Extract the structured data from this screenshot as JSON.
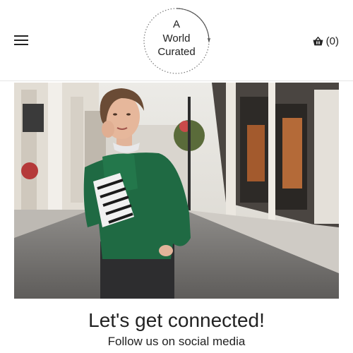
{
  "header": {
    "menu_icon": "hamburger-menu-icon",
    "logo": {
      "line1": "A",
      "line2": "World",
      "line3": "Curated"
    },
    "cart": {
      "icon": "shopping-basket-icon",
      "count_label": "(0)"
    }
  },
  "hero": {
    "image_alt": "Woman in green blouse on a city street"
  },
  "connect": {
    "heading": "Let's get connected!",
    "subheading": "Follow us on social media"
  }
}
